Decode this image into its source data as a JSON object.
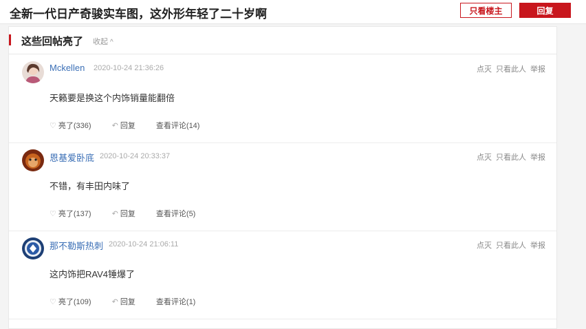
{
  "header": {
    "title": "全新一代日产奇骏实车图，这外形年轻了二十岁啊",
    "only_owner_label": "只看楼主",
    "reply_label": "回复"
  },
  "section": {
    "title": "这些回帖亮了",
    "collapse_label": "收起"
  },
  "post_ops": {
    "dislike": "点灭",
    "only_this": "只看此人",
    "report": "举报"
  },
  "posts": [
    {
      "user": "Mckellen",
      "time": "2020-10-24 21:36:26",
      "content": "天籁要是换这个内饰销量能翻倍",
      "like": "亮了(336)",
      "reply": "回复",
      "comments": "查看评论(14)"
    },
    {
      "user": "恩基爱卧底",
      "time": "2020-10-24 20:33:37",
      "content": "不错，有丰田内味了",
      "like": "亮了(137)",
      "reply": "回复",
      "comments": "查看评论(5)"
    },
    {
      "user": "那不勒斯热刺",
      "time": "2020-10-24 21:06:11",
      "content": "这内饰把RAV4锤爆了",
      "like": "亮了(109)",
      "reply": "回复",
      "comments": "查看评论(1)"
    }
  ],
  "colors": {
    "accent": "#c8161d",
    "username": "#3b6fb6"
  }
}
